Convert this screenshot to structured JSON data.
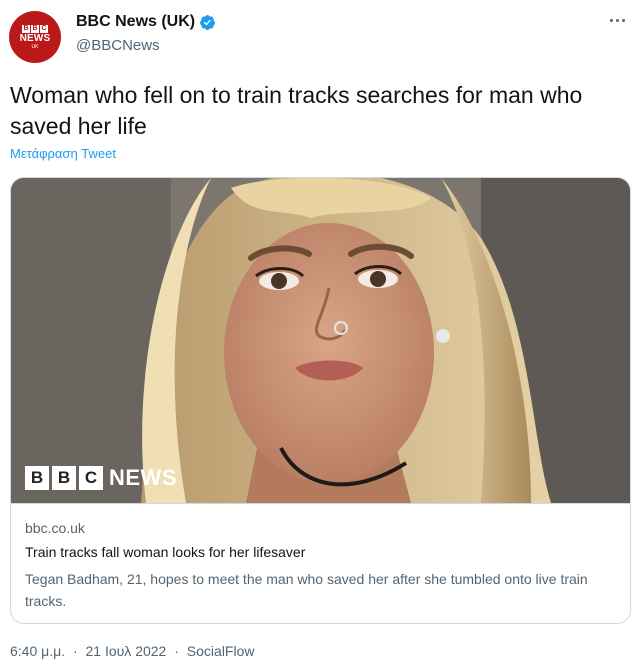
{
  "author": {
    "display_name": "BBC News (UK)",
    "handle": "@BBCNews",
    "avatar": {
      "blocks": [
        "B",
        "B",
        "C"
      ],
      "word": "NEWS",
      "region": "UK"
    },
    "verified_icon": "verified-badge-icon",
    "verified_color": "#1d9bf0"
  },
  "tweet": {
    "text": "Woman who fell on to train tracks searches for man who saved her life",
    "translate_label": "Μετάφραση Tweet"
  },
  "card": {
    "logo": {
      "blocks": [
        "B",
        "B",
        "C"
      ],
      "word": "NEWS"
    },
    "domain": "bbc.co.uk",
    "title": "Train tracks fall woman looks for her lifesaver",
    "description": "Tegan Badham, 21, hopes to meet the man who saved her after she tumbled onto live train tracks."
  },
  "meta": {
    "time": "6:40 μ.μ.",
    "separator": "·",
    "date": "21 Ιουλ 2022",
    "source": "SocialFlow"
  },
  "colors": {
    "brand_red": "#bb1919",
    "link_blue": "#1d9bf0",
    "secondary_text": "#536471"
  }
}
